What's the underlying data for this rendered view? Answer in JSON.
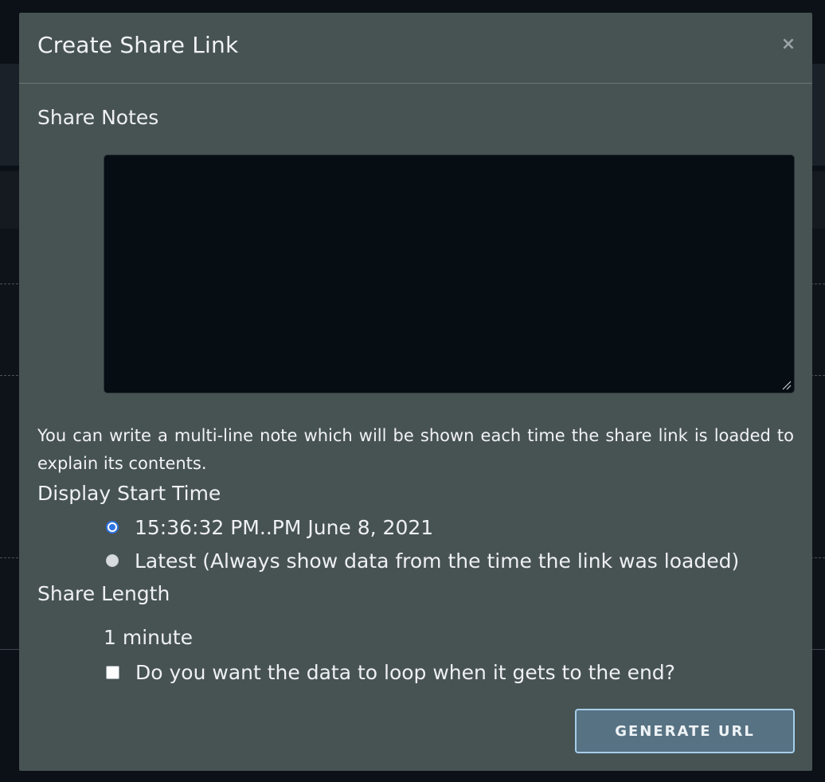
{
  "modal": {
    "title": "Create Share Link",
    "close_symbol": "×",
    "notes_label": "Share Notes",
    "notes_value": "",
    "notes_help": "You can write a multi-line note which will be shown each time the share link is loaded to explain its contents.",
    "start_time_label": "Display Start Time",
    "start_time_options": [
      {
        "label": "15:36:32 PM..PM June 8, 2021",
        "checked": true
      },
      {
        "label": "Latest (Always show data from the time the link was loaded)",
        "checked": false
      }
    ],
    "share_length_label": "Share Length",
    "share_length_value": "1 minute",
    "loop_label": "Do you want the data to loop when it gets to the end?",
    "loop_checked": false,
    "generate_button": "GENERATE URL"
  },
  "colors": {
    "modal_bg": "#475253",
    "accent_radio": "#2f73e0",
    "button_bg": "#577283",
    "button_border": "#a6cdea"
  }
}
